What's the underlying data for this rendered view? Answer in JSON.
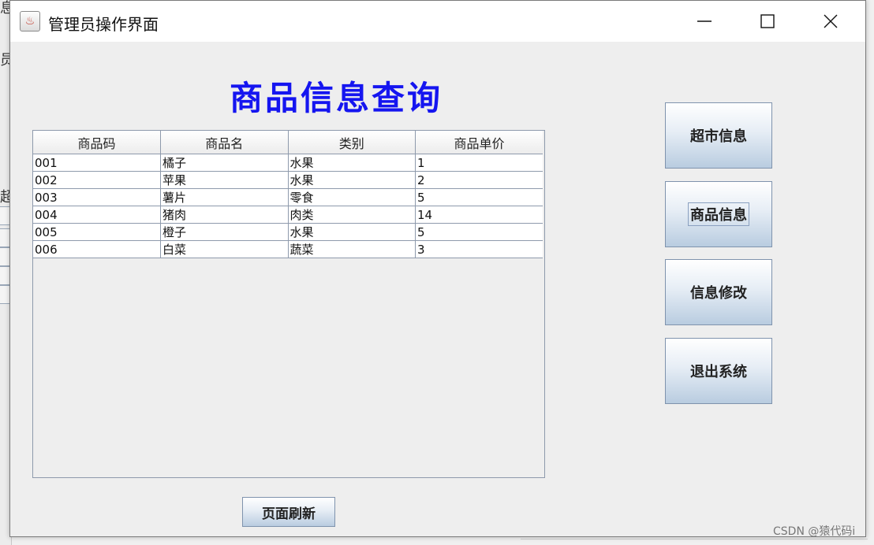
{
  "window": {
    "title": "管理员操作界面",
    "app_icon": "java-coffee-icon"
  },
  "background_fragments": [
    "息",
    "员",
    "超"
  ],
  "heading": "商品信息查询",
  "table": {
    "columns": [
      "商品码",
      "商品名",
      "类别",
      "商品单价"
    ],
    "rows": [
      [
        "001",
        "橘子",
        "水果",
        "1"
      ],
      [
        "002",
        "苹果",
        "水果",
        "2"
      ],
      [
        "003",
        "薯片",
        "零食",
        "5"
      ],
      [
        "004",
        "猪肉",
        "肉类",
        "14"
      ],
      [
        "005",
        "橙子",
        "水果",
        "5"
      ],
      [
        "006",
        "白菜",
        "蔬菜",
        "3"
      ]
    ]
  },
  "buttons": {
    "supermarket_info": "超市信息",
    "product_info": "商品信息",
    "info_modify": "信息修改",
    "exit_system": "退出系统",
    "refresh_page": "页面刷新"
  },
  "watermark": "CSDN @猿代码i"
}
